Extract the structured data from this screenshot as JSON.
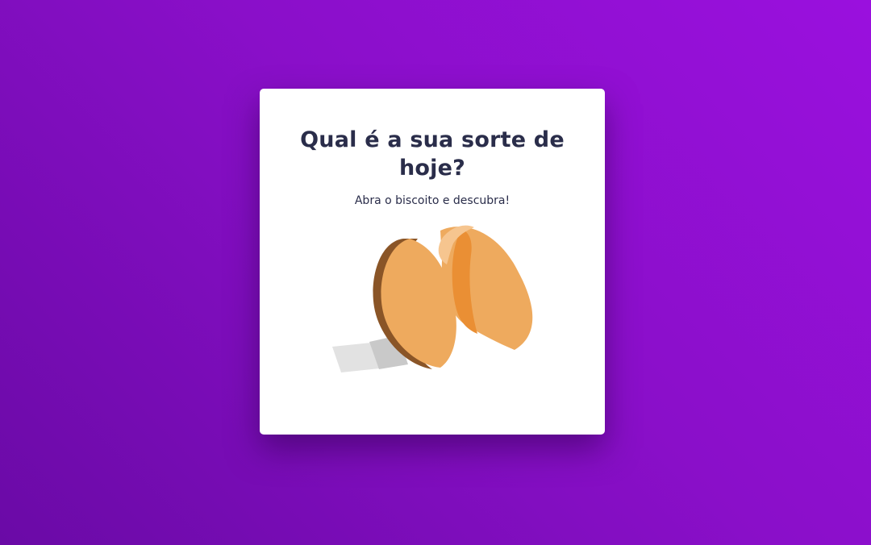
{
  "card": {
    "title": "Qual é a sua sorte de hoje?",
    "subtitle": "Abra o biscoito e descubra!"
  },
  "cookie": {
    "icon": "fortune-cookie-icon",
    "colors": {
      "shell": "#eeaa5e",
      "shell_inner": "#ea8f34",
      "shell_edge": "#8a5527",
      "highlight": "#f6c58f",
      "paper_light": "#e2e2e2",
      "paper_dark": "#c9c9c9"
    }
  },
  "colors": {
    "background_start": "#6a0aa6",
    "background_end": "#9a10de",
    "card": "#ffffff",
    "text": "#2a2d4a"
  }
}
